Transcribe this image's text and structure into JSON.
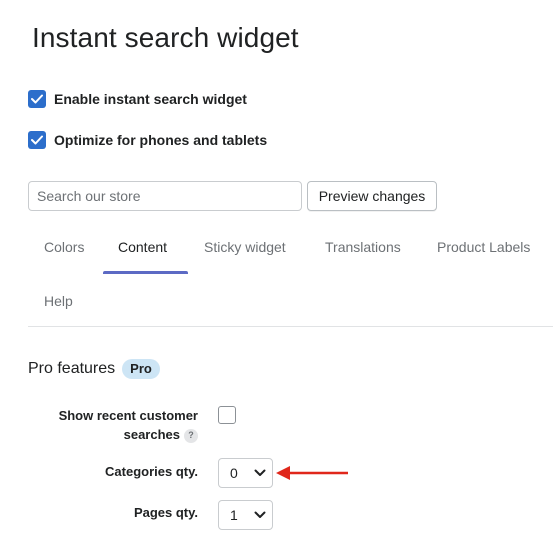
{
  "page": {
    "title": "Instant search widget"
  },
  "options": {
    "enable_widget": {
      "label": "Enable instant search widget",
      "checked": true
    },
    "optimize_mobile": {
      "label": "Optimize for phones and tablets",
      "checked": true
    }
  },
  "preview": {
    "search_placeholder": "Search our store",
    "button_label": "Preview changes"
  },
  "tabs": [
    {
      "label": "Colors",
      "active": false
    },
    {
      "label": "Content",
      "active": true
    },
    {
      "label": "Sticky widget",
      "active": false
    },
    {
      "label": "Translations",
      "active": false
    },
    {
      "label": "Product Labels",
      "active": false
    },
    {
      "label": "Help",
      "active": false
    }
  ],
  "pro_section": {
    "title": "Pro features",
    "badge": "Pro",
    "recent_searches": {
      "label_line1": "Show recent customer",
      "label_line2": "searches",
      "help": "?",
      "checked": false
    },
    "categories_qty": {
      "label": "Categories qty.",
      "value": "0"
    },
    "pages_qty": {
      "label": "Pages qty.",
      "value": "1"
    }
  },
  "colors": {
    "accent": "#2c6ecb",
    "tab_indicator": "#5c6ac4",
    "annotation_arrow": "#e0271b"
  },
  "icons": {
    "checkbox_check": "check-icon",
    "select_arrow": "chevron-down-icon",
    "help": "question-icon",
    "annotation": "red-arrow-icon"
  }
}
